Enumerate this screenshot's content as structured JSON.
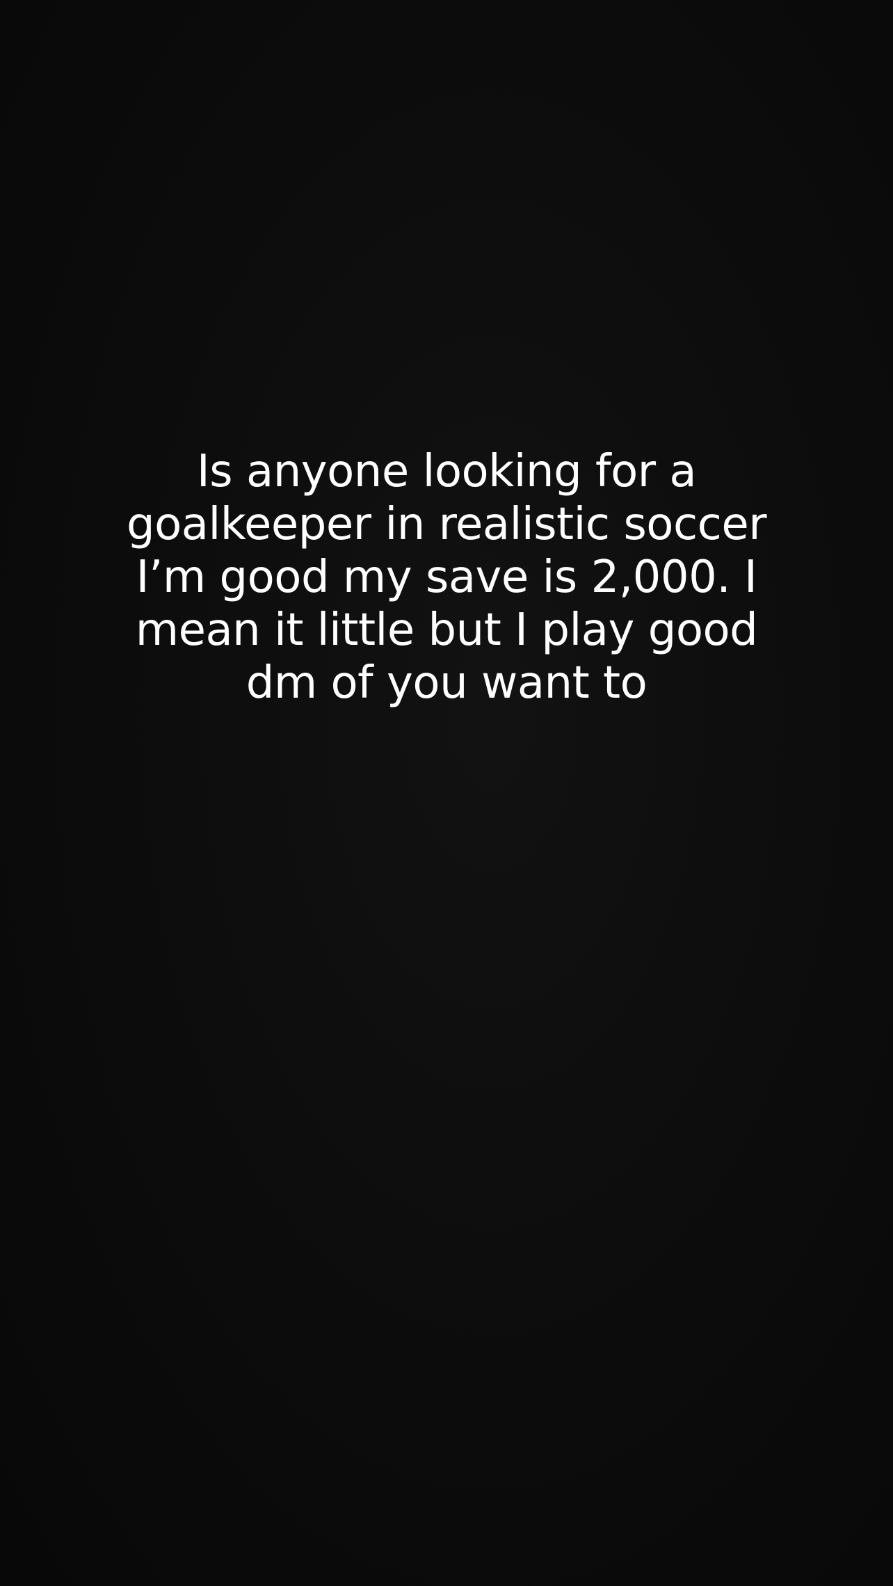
{
  "story": {
    "lines": [
      "Is anyone looking for a",
      "goalkeeper in realistic soccer",
      "I’m good my save is 2,000. I",
      "mean it little but I play good",
      "dm of you want to"
    ]
  },
  "colors": {
    "background": "#0b0b0b",
    "text": "#ffffff"
  }
}
